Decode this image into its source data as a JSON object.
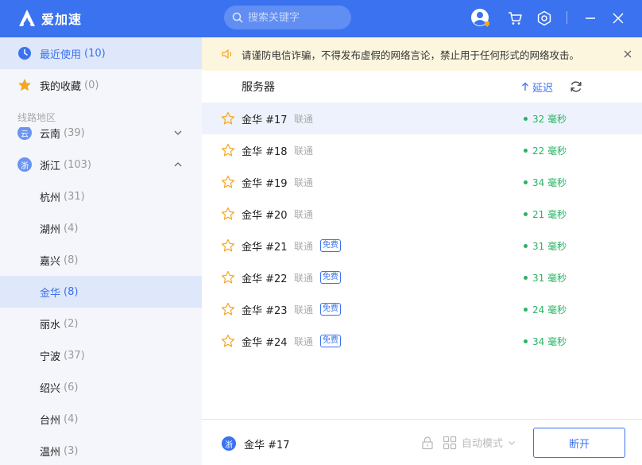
{
  "app": {
    "name": "爱加速"
  },
  "search": {
    "placeholder": "搜索关键字"
  },
  "colors": {
    "brand": "#3a72ef",
    "latency": "#28b463",
    "notice_bg": "#fdf6df"
  },
  "sidebar": {
    "recent": {
      "label": "最近使用",
      "count": "(10)"
    },
    "favorites": {
      "label": "我的收藏",
      "count": "(0)"
    },
    "section_title": "线路地区",
    "partial_province": {
      "badge": "云",
      "label": "云南",
      "count": "(39)"
    },
    "province": {
      "badge": "浙",
      "label": "浙江",
      "count": "(103)"
    },
    "cities": [
      {
        "label": "杭州",
        "count": "(31)"
      },
      {
        "label": "湖州",
        "count": "(4)"
      },
      {
        "label": "嘉兴",
        "count": "(8)"
      },
      {
        "label": "金华",
        "count": "(8)"
      },
      {
        "label": "丽水",
        "count": "(2)"
      },
      {
        "label": "宁波",
        "count": "(37)"
      },
      {
        "label": "绍兴",
        "count": "(6)"
      },
      {
        "label": "台州",
        "count": "(4)"
      },
      {
        "label": "温州",
        "count": "(3)"
      }
    ]
  },
  "notice": {
    "text": "请谨防电信诈骗，不得发布虚假的网络言论，禁止用于任何形式的网络攻击。"
  },
  "list": {
    "header": "服务器",
    "sort_label": "延迟",
    "servers": [
      {
        "name": "金华 #17",
        "isp": "联通",
        "free": "",
        "latency": "32 毫秒"
      },
      {
        "name": "金华 #18",
        "isp": "联通",
        "free": "",
        "latency": "22 毫秒"
      },
      {
        "name": "金华 #19",
        "isp": "联通",
        "free": "",
        "latency": "34 毫秒"
      },
      {
        "name": "金华 #20",
        "isp": "联通",
        "free": "",
        "latency": "21 毫秒"
      },
      {
        "name": "金华 #21",
        "isp": "联通",
        "free": "免费",
        "latency": "31 毫秒"
      },
      {
        "name": "金华 #22",
        "isp": "联通",
        "free": "免费",
        "latency": "31 毫秒"
      },
      {
        "name": "金华 #23",
        "isp": "联通",
        "free": "免费",
        "latency": "24 毫秒"
      },
      {
        "name": "金华 #24",
        "isp": "联通",
        "free": "免费",
        "latency": "34 毫秒"
      }
    ]
  },
  "footer": {
    "badge": "浙",
    "current": "金华 #17",
    "mode": "自动模式",
    "disconnect": "断开"
  }
}
